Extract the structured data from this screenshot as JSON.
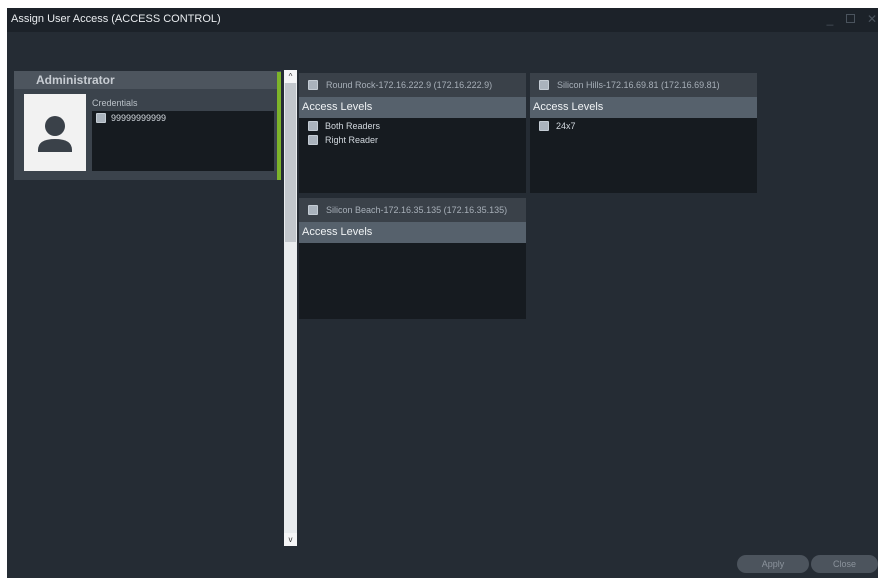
{
  "window": {
    "title": "Assign User Access (ACCESS CONTROL)",
    "controls": {
      "minimize": "_",
      "maximize": "□",
      "close": "✕"
    }
  },
  "user": {
    "name": "Administrator",
    "credentials_label": "Credentials",
    "credentials": [
      "99999999999"
    ],
    "avatar_icon": "user-silhouette-icon"
  },
  "panels": [
    {
      "title": "Round Rock-172.16.222.9 (172.16.222.9)",
      "section_label": "Access Levels",
      "items": [
        "Both Readers",
        "Right Reader"
      ]
    },
    {
      "title": "Silicon Hills-172.16.69.81 (172.16.69.81)",
      "section_label": "Access Levels",
      "items": [
        "24x7"
      ]
    },
    {
      "title": "Silicon Beach-172.16.35.135 (172.16.35.135)",
      "section_label": "Access Levels",
      "items": []
    }
  ],
  "scrollbar": {
    "up_glyph": "^",
    "down_glyph": "v"
  },
  "footer": {
    "apply_label": "Apply",
    "close_label": "Close"
  },
  "colors": {
    "background": "#252c34",
    "titlebar": "#1c2229",
    "accent_green": "#7db42a",
    "section_header": "#56616c",
    "list_bg": "#161b20"
  }
}
